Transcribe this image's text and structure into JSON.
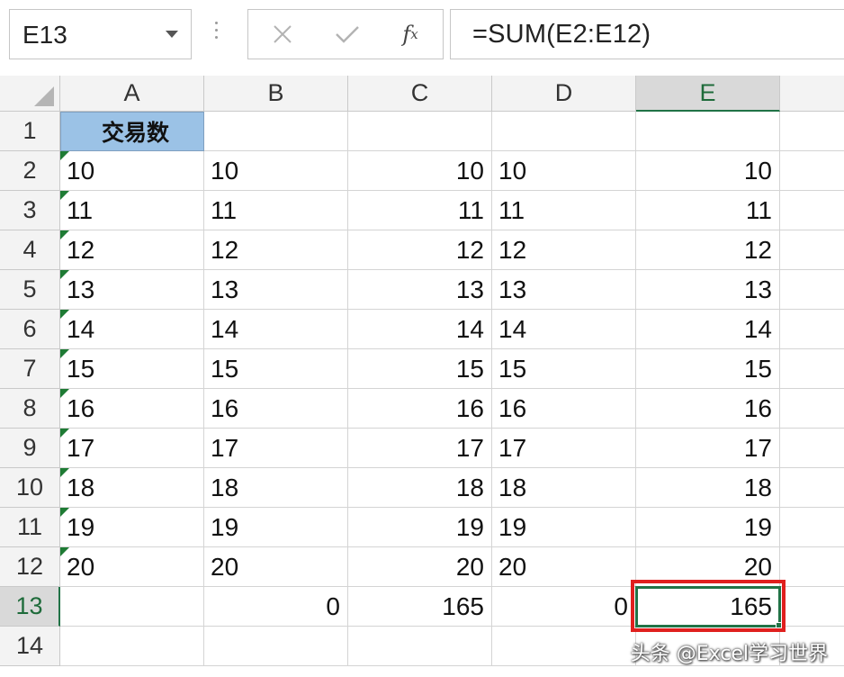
{
  "formula_bar": {
    "name_box": "E13",
    "fx_label": "f",
    "fx_sub": "x",
    "formula": "=SUM(E2:E12)"
  },
  "columns": [
    "A",
    "B",
    "C",
    "D",
    "E"
  ],
  "row_numbers": [
    "1",
    "2",
    "3",
    "4",
    "5",
    "6",
    "7",
    "8",
    "9",
    "10",
    "11",
    "12",
    "13",
    "14"
  ],
  "active_cell": "E13",
  "header_cell": {
    "ref": "A1",
    "value": "交易数",
    "fill_color": "#9bc2e6"
  },
  "rows": [
    [
      "10",
      "10",
      "10",
      "10",
      "10"
    ],
    [
      "11",
      "11",
      "11",
      "11",
      "11"
    ],
    [
      "12",
      "12",
      "12",
      "12",
      "12"
    ],
    [
      "13",
      "13",
      "13",
      "13",
      "13"
    ],
    [
      "14",
      "14",
      "14",
      "14",
      "14"
    ],
    [
      "15",
      "15",
      "15",
      "15",
      "15"
    ],
    [
      "16",
      "16",
      "16",
      "16",
      "16"
    ],
    [
      "17",
      "17",
      "17",
      "17",
      "17"
    ],
    [
      "18",
      "18",
      "18",
      "18",
      "18"
    ],
    [
      "19",
      "19",
      "19",
      "19",
      "19"
    ],
    [
      "20",
      "20",
      "20",
      "20",
      "20"
    ]
  ],
  "column_align": [
    "left",
    "left",
    "right",
    "left",
    "right"
  ],
  "text_number_indicator_column": "A",
  "totals_row": [
    "",
    "0",
    "165",
    "0",
    "165"
  ],
  "highlight_color": "#e0201e",
  "accent_color": "#217346",
  "watermark": "头条 @Excel学习世界"
}
